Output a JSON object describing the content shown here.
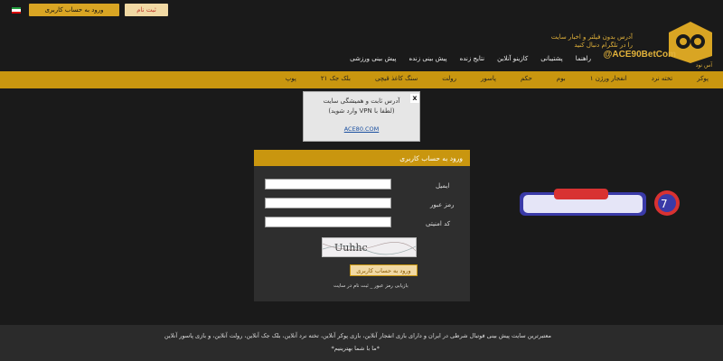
{
  "topbar": {
    "login_label": "ورود به حساب کاربری",
    "signup_label": "ثبت نام"
  },
  "header": {
    "tagline1": "آدرس بدون فیلتر و اخبار سایت",
    "tagline2": "را در تلگرام دنبال کنید",
    "telegram_handle": "@ACE90BetCom",
    "brand_subtitle": "آس نود"
  },
  "main_nav": [
    "پیش بینی ورزشی",
    "پیش بینی زنده",
    "نتایج زنده",
    "کازینو آنلاین",
    "پشتیبانی",
    "راهنما"
  ],
  "casino_nav": [
    "پوکر",
    "تخته نرد",
    "انفجار ورژن ۱",
    "بوم",
    "حکم",
    "پاسور",
    "رولت",
    "سنگ کاغذ قیچی",
    "بلک جک ۲۱",
    "پوپ"
  ],
  "popup": {
    "line1": "آدرس ثابت و همیشگی سایت",
    "line2": "(لطفا با VPN وارد شوید)",
    "link": "ACE80.COM",
    "close": "x"
  },
  "login": {
    "title": "ورود به حساب کاربری",
    "email_label": "ایمیل",
    "password_label": "رمز عبور",
    "captcha_label": "کد امنیتی",
    "captcha_text": "Uuhhc",
    "submit_label": "ورود به حساب کاربری",
    "links": "بازیابی رمز عبور _ ثبت نام در سایت"
  },
  "footer": {
    "line1": "معتبرترین سایت پیش بینی فوتبال شرطی در ایران و دارای بازی انفجار آنلاین، بازی پوکر آنلاین، تخته نرد آنلاین، بلک جک آنلاین، رولت آنلاین، و بازی پاسور آنلاین",
    "line2": "*ما با شما بهترینیم*"
  },
  "colors": {
    "gold": "#c9960f",
    "dark": "#1a1a1a"
  }
}
